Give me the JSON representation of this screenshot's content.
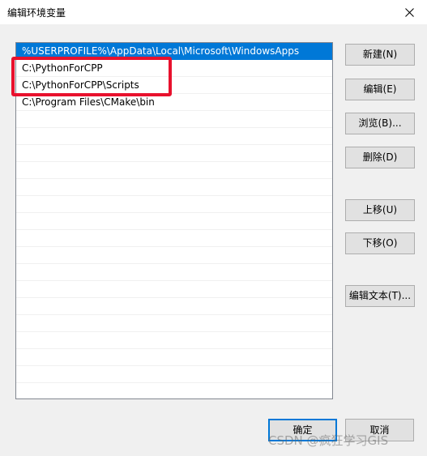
{
  "window": {
    "title": "编辑环境变量"
  },
  "path_list": {
    "items": [
      {
        "value": "%USERPROFILE%\\AppData\\Local\\Microsoft\\WindowsApps",
        "selected": true
      },
      {
        "value": "C:\\PythonForCPP",
        "selected": false
      },
      {
        "value": "C:\\PythonForCPP\\Scripts",
        "selected": false
      },
      {
        "value": "C:\\Program Files\\CMake\\bin",
        "selected": false
      }
    ]
  },
  "buttons": {
    "new": "新建(N)",
    "edit": "编辑(E)",
    "browse": "浏览(B)...",
    "delete": "删除(D)",
    "move_up": "上移(U)",
    "move_down": "下移(O)",
    "edit_text": "编辑文本(T)...",
    "ok": "确定",
    "cancel": "取消"
  },
  "watermark": {
    "text": "CSDN @疯狂学习GIS"
  },
  "colors": {
    "selection": "#0078d7",
    "annotation_red": "#e8112d",
    "dialog_bg": "#f0f0f0"
  }
}
